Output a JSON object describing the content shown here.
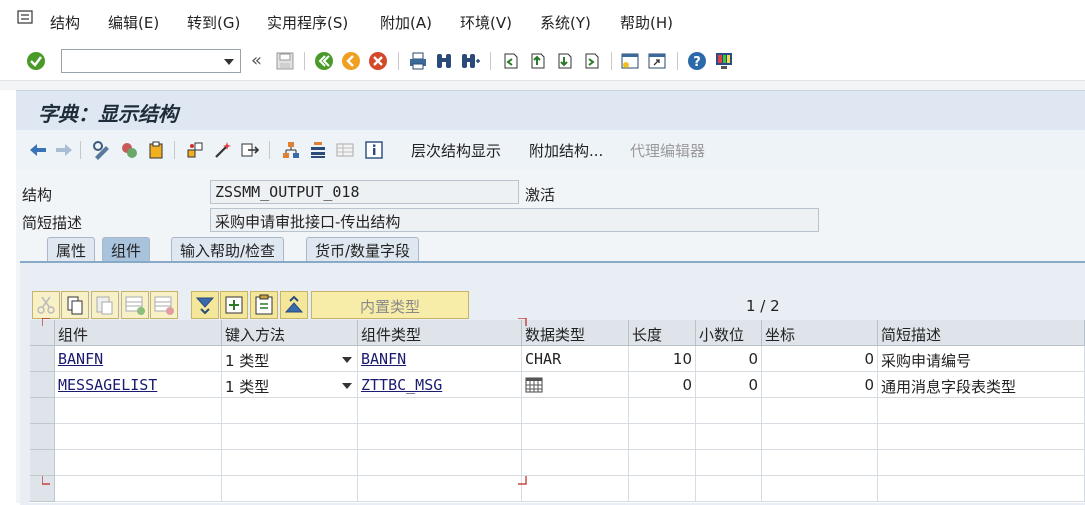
{
  "menubar": {
    "items": [
      "结构",
      "编辑(E)",
      "转到(G)",
      "实用程序(S)",
      "附加(A)",
      "环境(V)",
      "系统(Y)",
      "帮助(H)"
    ]
  },
  "toolbar": {
    "command_value": "",
    "icons": [
      "check-icon",
      "back-arrows-icon",
      "save-icon",
      "back-icon",
      "exit-icon",
      "cancel-icon",
      "print-icon",
      "find-icon",
      "find-next-icon",
      "first-page-icon",
      "prev-page-icon",
      "next-page-icon",
      "last-page-icon",
      "new-session-icon",
      "shortcut-icon",
      "help-icon",
      "customize-layout-icon"
    ]
  },
  "title": "字典：显示结构",
  "app_toolbar": {
    "hierarchy_label": "层次结构显示",
    "append_label": "附加结构...",
    "proxy_label": "代理编辑器"
  },
  "header": {
    "structure_label": "结构",
    "structure_value": "ZSSMM_OUTPUT_018",
    "status": "激活",
    "desc_label": "简短描述",
    "desc_value": "采购申请审批接口-传出结构"
  },
  "tabs": [
    {
      "label": "属性",
      "active": false
    },
    {
      "label": "组件",
      "active": true
    },
    {
      "label": "输入帮助/检查",
      "active": false
    },
    {
      "label": "货币/数量字段",
      "active": false
    }
  ],
  "table_toolbar": {
    "builtin_type_label": "内置类型",
    "pager": "1 / 2"
  },
  "table": {
    "columns": [
      "组件",
      "键入方法",
      "组件类型",
      "数据类型",
      "长度",
      "小数位",
      "坐标",
      "简短描述"
    ],
    "rows": [
      {
        "component": "BANFN",
        "typing": "1 类型",
        "comp_type": "BANFN",
        "data_type": "CHAR",
        "length": "10",
        "decimals": "0",
        "coord": "0",
        "desc": "采购申请编号"
      },
      {
        "component": "MESSAGELIST",
        "typing": "1 类型",
        "comp_type": "ZTTBC_MSG",
        "data_type": "table-icon",
        "length": "0",
        "decimals": "0",
        "coord": "0",
        "desc": "通用消息字段表类型"
      }
    ]
  },
  "colors": {
    "title_bg": "#dfe8f2",
    "active_tab": "#a9c3dd",
    "toolbar_button": "#f8f1c8"
  }
}
